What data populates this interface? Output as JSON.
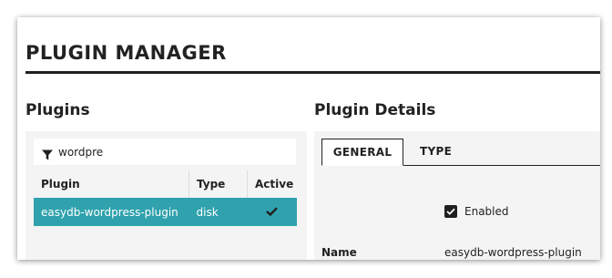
{
  "page": {
    "title": "PLUGIN MANAGER"
  },
  "plugins_panel": {
    "title": "Plugins",
    "filter": {
      "value": "wordpre",
      "icon": "filter-icon"
    },
    "columns": [
      "Plugin",
      "Type",
      "Active"
    ],
    "rows": [
      {
        "plugin": "easydb-wordpress-plugin",
        "type": "disk",
        "active": true
      }
    ],
    "selected_color": "#2fa2ad"
  },
  "details_panel": {
    "title": "Plugin Details",
    "tabs": [
      {
        "label": "GENERAL",
        "active": true
      },
      {
        "label": "TYPE",
        "active": false
      }
    ],
    "enabled": {
      "label": "Enabled",
      "checked": true
    },
    "name": {
      "label": "Name",
      "value": "easydb-wordpress-plugin"
    }
  }
}
